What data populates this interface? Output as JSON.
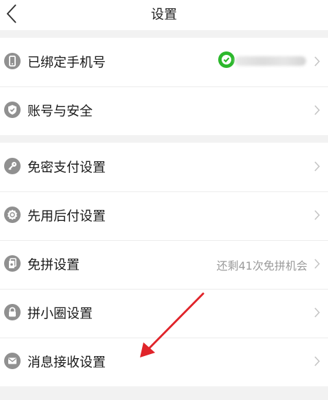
{
  "header": {
    "title": "设置"
  },
  "group1": {
    "items": [
      {
        "label": "已绑定手机号",
        "value": "",
        "icon": "phone-icon"
      },
      {
        "label": "账号与安全",
        "value": "",
        "icon": "shield-icon"
      }
    ]
  },
  "group2": {
    "items": [
      {
        "label": "免密支付设置",
        "value": "",
        "icon": "key-icon"
      },
      {
        "label": "先用后付设置",
        "value": "",
        "icon": "badge-icon"
      },
      {
        "label": "免拼设置",
        "value": "还剩41次免拼机会",
        "icon": "card-icon"
      },
      {
        "label": "拼小圈设置",
        "value": "",
        "icon": "lock-icon"
      },
      {
        "label": "消息接收设置",
        "value": "",
        "icon": "mail-icon"
      }
    ]
  },
  "colors": {
    "verified": "#2cb82c",
    "annotation_arrow": "#e0242a",
    "icon": "#909090"
  }
}
